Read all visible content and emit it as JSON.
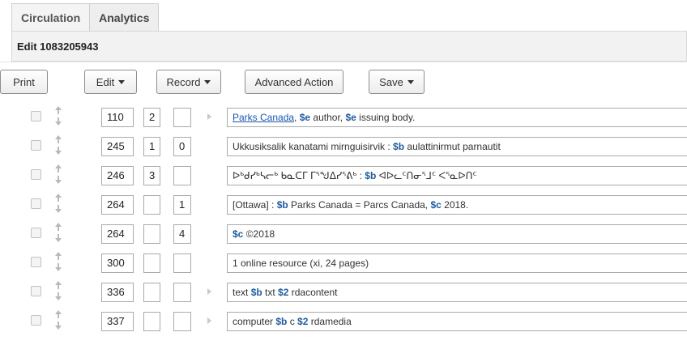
{
  "tabs": [
    "Circulation",
    "Analytics"
  ],
  "edit_title": "Edit 1083205943",
  "toolbar": {
    "print": "Print",
    "edit": "Edit",
    "record": "Record",
    "advanced": "Advanced Action",
    "save": "Save"
  },
  "fields": [
    {
      "tag": "110",
      "ind1": "2",
      "ind2": "",
      "arrow": true,
      "parts": [
        {
          "t": "link",
          "v": "Parks Canada"
        },
        {
          "t": "text",
          "v": ", "
        },
        {
          "t": "sf",
          "v": "$e"
        },
        {
          "t": "text",
          "v": " author, "
        },
        {
          "t": "sf",
          "v": "$e"
        },
        {
          "t": "text",
          "v": " issuing body."
        }
      ]
    },
    {
      "tag": "245",
      "ind1": "1",
      "ind2": "0",
      "arrow": false,
      "parts": [
        {
          "t": "text",
          "v": "Ukkusiksalik kanatami mirnguisirvik : "
        },
        {
          "t": "sf",
          "v": "$b"
        },
        {
          "t": "text",
          "v": " aulattinirmut parnautit"
        }
      ]
    },
    {
      "tag": "246",
      "ind1": "3",
      "ind2": "",
      "arrow": false,
      "parts": [
        {
          "t": "text",
          "v": "ᐅᒃᑯᓯᒃᓴᓕᒃ ᑲᓇᑕᒥ ᒥᕐᖑᐃᓯᕐᕕᒃ : "
        },
        {
          "t": "sf",
          "v": "$b"
        },
        {
          "t": "text",
          "v": " ᐊᐅᓚᑦᑎᓂᕐᒧᑦ ᐸᕐᓇᐅᑎᑦ"
        }
      ]
    },
    {
      "tag": "264",
      "ind1": "",
      "ind2": "1",
      "arrow": false,
      "parts": [
        {
          "t": "text",
          "v": "[Ottawa] : "
        },
        {
          "t": "sf",
          "v": "$b"
        },
        {
          "t": "text",
          "v": " Parks Canada = Parcs Canada, "
        },
        {
          "t": "sf",
          "v": "$c"
        },
        {
          "t": "text",
          "v": " 2018."
        }
      ]
    },
    {
      "tag": "264",
      "ind1": "",
      "ind2": "4",
      "arrow": false,
      "parts": [
        {
          "t": "sf",
          "v": "$c"
        },
        {
          "t": "text",
          "v": " ©2018"
        }
      ]
    },
    {
      "tag": "300",
      "ind1": "",
      "ind2": "",
      "arrow": false,
      "parts": [
        {
          "t": "text",
          "v": "1 online resource (xi, 24 pages)"
        }
      ]
    },
    {
      "tag": "336",
      "ind1": "",
      "ind2": "",
      "arrow": true,
      "parts": [
        {
          "t": "text",
          "v": "text "
        },
        {
          "t": "sf",
          "v": "$b"
        },
        {
          "t": "text",
          "v": " txt "
        },
        {
          "t": "sf",
          "v": "$2"
        },
        {
          "t": "text",
          "v": " rdacontent"
        }
      ]
    },
    {
      "tag": "337",
      "ind1": "",
      "ind2": "",
      "arrow": true,
      "parts": [
        {
          "t": "text",
          "v": "computer "
        },
        {
          "t": "sf",
          "v": "$b"
        },
        {
          "t": "text",
          "v": " c "
        },
        {
          "t": "sf",
          "v": "$2"
        },
        {
          "t": "text",
          "v": " rdamedia"
        }
      ]
    }
  ]
}
